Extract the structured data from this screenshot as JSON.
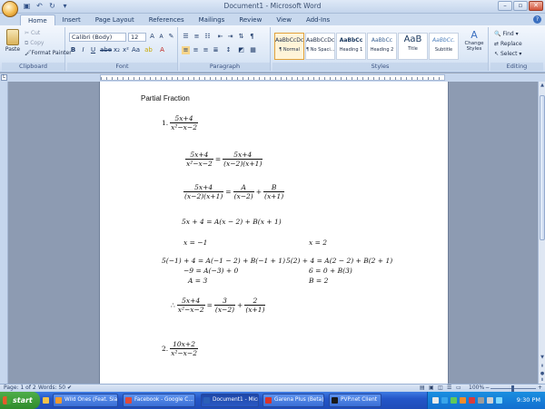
{
  "window": {
    "title": "Document1 - Microsoft Word",
    "controls": [
      "–",
      "▫",
      "✕"
    ]
  },
  "quick_access": [
    "save",
    "undo",
    "redo",
    "customize"
  ],
  "tabs": [
    "Home",
    "Insert",
    "Page Layout",
    "References",
    "Mailings",
    "Review",
    "View",
    "Add-Ins"
  ],
  "clipboard": {
    "paste": "Paste",
    "cut": "Cut",
    "copy": "Copy",
    "format_painter": "Format Painter",
    "label": "Clipboard"
  },
  "font": {
    "name": "Calibri (Body)",
    "size": "12",
    "label": "Font"
  },
  "paragraph": {
    "label": "Paragraph"
  },
  "styles": {
    "items": [
      {
        "preview": "AaBbCcDc",
        "name": "¶ Normal",
        "selected": true
      },
      {
        "preview": "AaBbCcDc",
        "name": "¶ No Spaci...",
        "selected": false
      },
      {
        "preview": "AaBbCc",
        "name": "Heading 1",
        "selected": false
      },
      {
        "preview": "AaBbCc",
        "name": "Heading 2",
        "selected": false
      },
      {
        "preview": "AaB",
        "name": "Title",
        "selected": false
      },
      {
        "preview": "AaBbCc.",
        "name": "Subtitle",
        "selected": false
      }
    ],
    "change_styles": "Change Styles",
    "label": "Styles"
  },
  "editing": {
    "find": "Find",
    "replace": "Replace",
    "select": "Select",
    "label": "Editing"
  },
  "document": {
    "heading": "Partial Fraction",
    "p1_label": "1.",
    "p1_num": "5x+4",
    "p1_den": "x²−x−2",
    "eq1_lhs_num": "5x+4",
    "eq1_lhs_den": "x²−x−2",
    "eq1_rhs_num": "5x+4",
    "eq1_rhs_den": "(x−2)(x+1)",
    "eq2_lhs_num": "5x+4",
    "eq2_lhs_den": "(x−2)(x+1)",
    "eq2_a_num": "A",
    "eq2_a_den": "(x−2)",
    "eq2_b_num": "B",
    "eq2_b_den": "(x+1)",
    "eq3": "5x + 4 = A(x − 2) + B(x + 1)",
    "case_left": "x = −1",
    "case_right": "x = 2",
    "left_1": "5(−1) + 4 = A(−1 − 2) + B(−1 + 1)",
    "left_2": "−9 = A(−3) + 0",
    "left_3": "A = 3",
    "right_1": "5(2) + 4 = A(2 − 2) + B(2 + 1)",
    "right_2": "6 = 0 + B(3)",
    "right_3": "B = 2",
    "therefore": "∴",
    "res_lhs_num": "5x+4",
    "res_lhs_den": "x²−x−2",
    "res_a_num": "3",
    "res_a_den": "(x−2)",
    "res_b_num": "2",
    "res_b_den": "(x+1)",
    "p2_label": "2.",
    "p2_num": "10x+2",
    "p2_den": "x²−x−2"
  },
  "status": {
    "page": "Page: 1 of 2",
    "words": "Words: 50",
    "zoom": "100%"
  },
  "taskbar": {
    "start": "start",
    "tasks": [
      {
        "label": "Wild Ones (Feat. Sia)...",
        "color": "#f29a2e",
        "active": false
      },
      {
        "label": "Facebook - Google C...",
        "color": "#e04a3a",
        "active": false
      },
      {
        "label": "Document1 - Microsof...",
        "color": "#2b5fb8",
        "active": true
      },
      {
        "label": "Garena Plus (Beta) - Il...",
        "color": "#d9342b",
        "active": false
      },
      {
        "label": "PVP.net Client",
        "color": "#1a1a1a",
        "active": false
      }
    ],
    "clock": "9:30 PM"
  },
  "colors": {
    "ribbon": "#dbe7f6",
    "taskbar": "#2456c8",
    "start": "#2f8b2c",
    "selected_style": "#e2a23a"
  }
}
